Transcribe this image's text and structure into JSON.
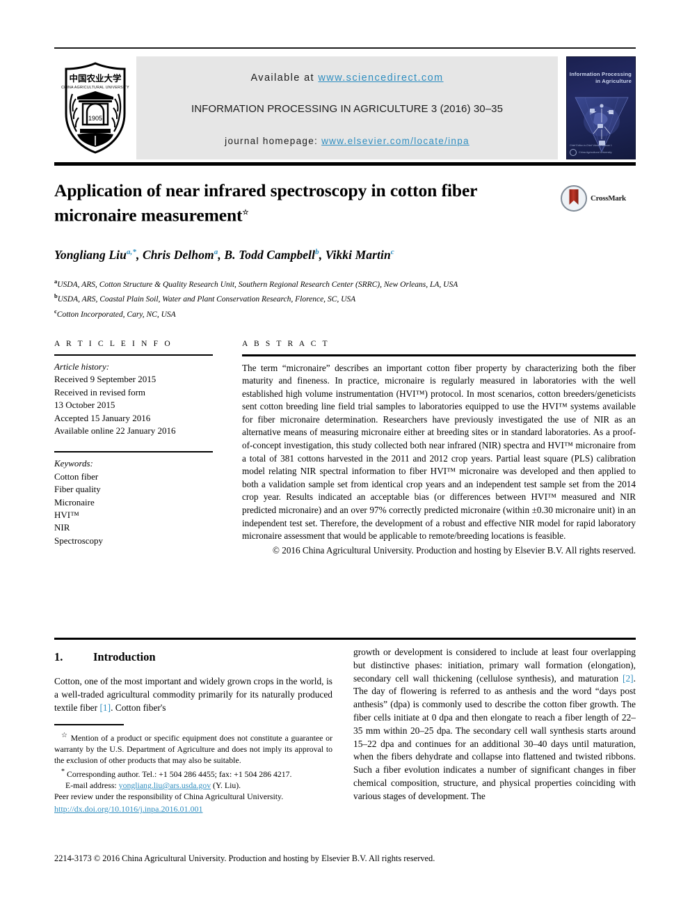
{
  "header": {
    "available_prefix": "Available at ",
    "sciencedirect_url": "www.sciencedirect.com",
    "journal_running_head": "INFORMATION PROCESSING IN AGRICULTURE 3 (2016) 30–35",
    "homepage_prefix": "journal homepage: ",
    "homepage_url": "www.elsevier.com/locate/inpa",
    "publisher_logo_name": "China Agricultural University",
    "publisher_logo_year": "1905",
    "publisher_logo_cn": "中国农业大学",
    "publisher_logo_en": "CHINA AGRICULTURAL UNIVERSITY",
    "cover_title_line1": "Information Processing",
    "cover_title_line2": "in Agriculture",
    "cover_footer": "Chief Editor-in-Chief\nVolume 3 Issue 1",
    "cover_badge": "China Agricultural University"
  },
  "article": {
    "title": "Application of near infrared spectroscopy in cotton fiber micronaire measurement",
    "title_footnote_mark": "☆",
    "crossmark_label": "CrossMark",
    "authors": [
      {
        "name": "Yongliang Liu",
        "marks": "a,*"
      },
      {
        "name": "Chris Delhom",
        "marks": "a"
      },
      {
        "name": "B. Todd Campbell",
        "marks": "b"
      },
      {
        "name": "Vikki Martin",
        "marks": "c"
      }
    ],
    "affiliations": [
      {
        "mark": "a",
        "text": "USDA, ARS, Cotton Structure & Quality Research Unit, Southern Regional Research Center (SRRC), New Orleans, LA, USA"
      },
      {
        "mark": "b",
        "text": "USDA, ARS, Coastal Plain Soil, Water and Plant Conservation Research, Florence, SC, USA"
      },
      {
        "mark": "c",
        "text": "Cotton Incorporated, Cary, NC, USA"
      }
    ]
  },
  "article_info": {
    "heading": "A R T I C L E   I N F O",
    "history_label": "Article history:",
    "history": [
      "Received 9 September 2015",
      "Received in revised form",
      "13 October 2015",
      "Accepted 15 January 2016",
      "Available online 22 January 2016"
    ],
    "keywords_label": "Keywords:",
    "keywords": [
      "Cotton fiber",
      "Fiber quality",
      "Micronaire",
      "HVI™",
      "NIR",
      "Spectroscopy"
    ]
  },
  "abstract": {
    "heading": "A B S T R A C T",
    "text": "The term “micronaire” describes an important cotton fiber property by characterizing both the fiber maturity and fineness. In practice, micronaire is regularly measured in laboratories with the well established high volume instrumentation (HVI™) protocol. In most scenarios, cotton breeders/geneticists sent cotton breeding line field trial samples to laboratories equipped to use the HVI™ systems available for fiber micronaire determination. Researchers have previously investigated the use of NIR as an alternative means of measuring micronaire either at breeding sites or in standard laboratories. As a proof-of-concept investigation, this study collected both near infrared (NIR) spectra and HVI™ micronaire from a total of 381 cottons harvested in the 2011 and 2012 crop years. Partial least square (PLS) calibration model relating NIR spectral information to fiber HVI™ micronaire was developed and then applied to both a validation sample set from identical crop years and an independent test sample set from the 2014 crop year. Results indicated an acceptable bias (or differences between HVI™ measured and NIR predicted micronaire) and an over 97% correctly predicted micronaire (within ±0.30 micronaire unit) in an independent test set. Therefore, the development of a robust and effective NIR model for rapid laboratory micronaire assessment that would be applicable to remote/breeding locations is feasible.",
    "copyright": "© 2016 China Agricultural University. Production and hosting by Elsevier B.V. All rights reserved."
  },
  "body": {
    "section_number": "1.",
    "section_title": "Introduction",
    "left_paragraph": "Cotton, one of the most important and widely grown crops in the world, is a well-traded agricultural commodity primarily for its naturally produced textile fiber [1]. Cotton fiber's",
    "left_ref": "[1]",
    "right_paragraph": "growth or development is considered to include at least four overlapping but distinctive phases: initiation, primary wall formation (elongation), secondary cell wall thickening (cellulose synthesis), and maturation [2]. The day of flowering is referred to as anthesis and the word “days post anthesis” (dpa) is commonly used to describe the cotton fiber growth. The fiber cells initiate at 0 dpa and then elongate to reach a fiber length of 22–35 mm within 20–25 dpa. The secondary cell wall synthesis starts around 15–22 dpa and continues for an additional 30–40 days until maturation, when the fibers dehydrate and collapse into flattened and twisted ribbons. Such a fiber evolution indicates a number of significant changes in fiber chemical composition, structure, and physical properties coinciding with various stages of development. The",
    "right_ref": "[2]"
  },
  "footnotes": {
    "star_mark": "☆",
    "star_text": "Mention of a product or specific equipment does not constitute a guarantee or warranty by the U.S. Department of Agriculture and does not imply its approval to the exclusion of other products that may also be suitable.",
    "corr_mark": "*",
    "corr_text": "Corresponding author. Tel.: +1 504 286 4455; fax: +1 504 286 4217.",
    "email_label": "E-mail address:",
    "email": "yongliang.liu@ars.usda.gov",
    "email_suffix": "(Y. Liu).",
    "peer_review": "Peer review under the responsibility of China Agricultural University.",
    "doi": "http://dx.doi.org/10.1016/j.inpa.2016.01.001",
    "issn_line": "2214-3173 © 2016 China Agricultural University. Production and hosting by Elsevier B.V. All rights reserved."
  },
  "colors": {
    "link_blue": "#2f8ec0",
    "banner_grey": "#e6e6e6",
    "rule_black": "#000000",
    "crossmark_red": "#c0392b"
  }
}
